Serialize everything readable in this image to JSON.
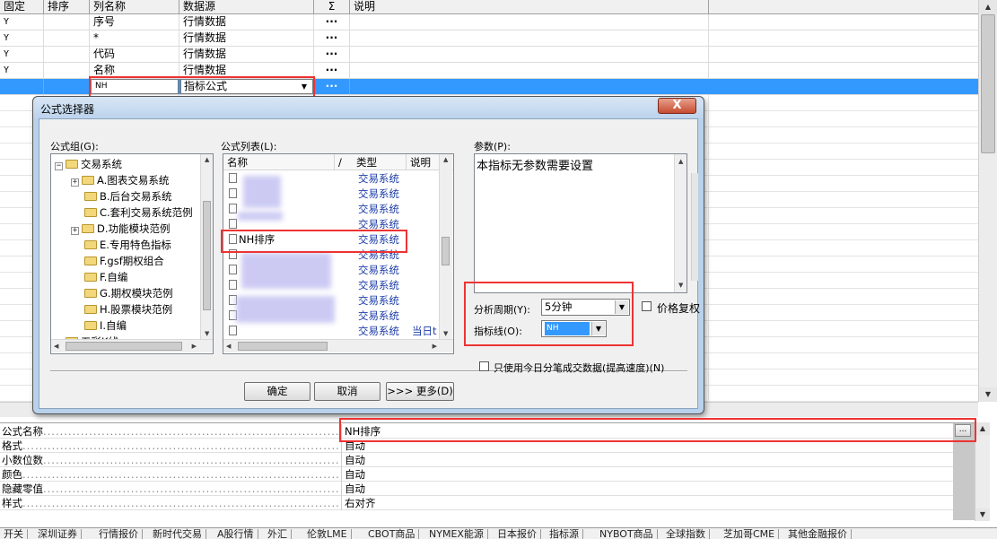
{
  "grid": {
    "columns": [
      "固定",
      "排序",
      "列名称",
      "数据源",
      "Σ",
      "说明"
    ],
    "rows": [
      {
        "fixed": "Y",
        "sort": "",
        "name": "序号",
        "source": "行情数据",
        "sigma": "···",
        "desc": ""
      },
      {
        "fixed": "Y",
        "sort": "",
        "name": "*",
        "source": "行情数据",
        "sigma": "···",
        "desc": ""
      },
      {
        "fixed": "Y",
        "sort": "",
        "name": "代码",
        "source": "行情数据",
        "sigma": "···",
        "desc": ""
      },
      {
        "fixed": "Y",
        "sort": "",
        "name": "名称",
        "source": "行情数据",
        "sigma": "···",
        "desc": ""
      }
    ],
    "selected_row": {
      "name": "NH",
      "source": "指标公式",
      "sigma": "···"
    }
  },
  "dialog": {
    "title": "公式选择器",
    "close_label": "X",
    "group_label": "公式组(G):",
    "list_label": "公式列表(L):",
    "params_label": "参数(P):",
    "tree": {
      "root": "交易系统",
      "items": [
        {
          "label": "A.图表交易系统",
          "expand": "+"
        },
        {
          "label": "B.后台交易系统",
          "expand": ""
        },
        {
          "label": "C.套利交易系统范例",
          "expand": ""
        },
        {
          "label": "D.功能模块范例",
          "expand": "+"
        },
        {
          "label": "E.专用特色指标",
          "expand": ""
        },
        {
          "label": "F.gsf期权组合",
          "expand": ""
        },
        {
          "label": "F.自编",
          "expand": ""
        },
        {
          "label": "G.期权模块范例",
          "expand": ""
        },
        {
          "label": "H.股票模块范例",
          "expand": ""
        },
        {
          "label": "I.自编",
          "expand": ""
        }
      ],
      "partial_item": "五彩K线"
    },
    "formula_list": {
      "headers": [
        "名称",
        "/",
        "类型",
        "说明"
      ],
      "rows": [
        {
          "name": "",
          "type": "交易系统",
          "desc": ""
        },
        {
          "name": "",
          "type": "交易系统",
          "desc": ""
        },
        {
          "name": "",
          "type": "交易系统",
          "desc": ""
        },
        {
          "name": "",
          "type": "交易系统",
          "desc": ""
        },
        {
          "name": "NH排序",
          "type": "交易系统",
          "desc": ""
        },
        {
          "name": "",
          "type": "交易系统",
          "desc": ""
        },
        {
          "name": "",
          "type": "交易系统",
          "desc": ""
        },
        {
          "name": "",
          "type": "交易系统",
          "desc": ""
        },
        {
          "name": "",
          "type": "交易系统",
          "desc": ""
        },
        {
          "name": "",
          "type": "交易系统",
          "desc": ""
        },
        {
          "name": "",
          "type": "交易系统",
          "desc": "当日t"
        }
      ]
    },
    "params_text": "本指标无参数需要设置",
    "period_label": "分析周期(Y):",
    "period_value": "5分钟",
    "indicator_label": "指标线(O):",
    "indicator_value": "NH",
    "price_adjust_label": "价格复权",
    "today_only_label": "只使用今日分笔成交数据(提高速度)(N)",
    "buttons": {
      "ok": "确定",
      "cancel": "取消",
      "more": ">>> 更多(D)"
    }
  },
  "props": {
    "rows": [
      {
        "key": "公式名称",
        "value": "NH排序"
      },
      {
        "key": "格式",
        "value": "自动"
      },
      {
        "key": "小数位数",
        "value": "自动"
      },
      {
        "key": "颜色",
        "value": "自动"
      },
      {
        "key": "隐藏零值",
        "value": "自动"
      },
      {
        "key": "样式",
        "value": "右对齐"
      }
    ],
    "ellipsis": "..."
  },
  "bottom_tabs": [
    "开关",
    "深圳证券",
    "行情报价",
    "新时代交易",
    "A股行情",
    "外汇",
    "伦敦LME",
    "CBOT商品",
    "NYMEX能源",
    "日本报价",
    "指标源",
    "NYBOT商品",
    "全球指数",
    "芝加哥CME",
    "其他金融报价"
  ],
  "colors": {
    "selection": "#3399ff",
    "highlight_box": "#e33333",
    "list_type_text": "#1c3ca8"
  }
}
